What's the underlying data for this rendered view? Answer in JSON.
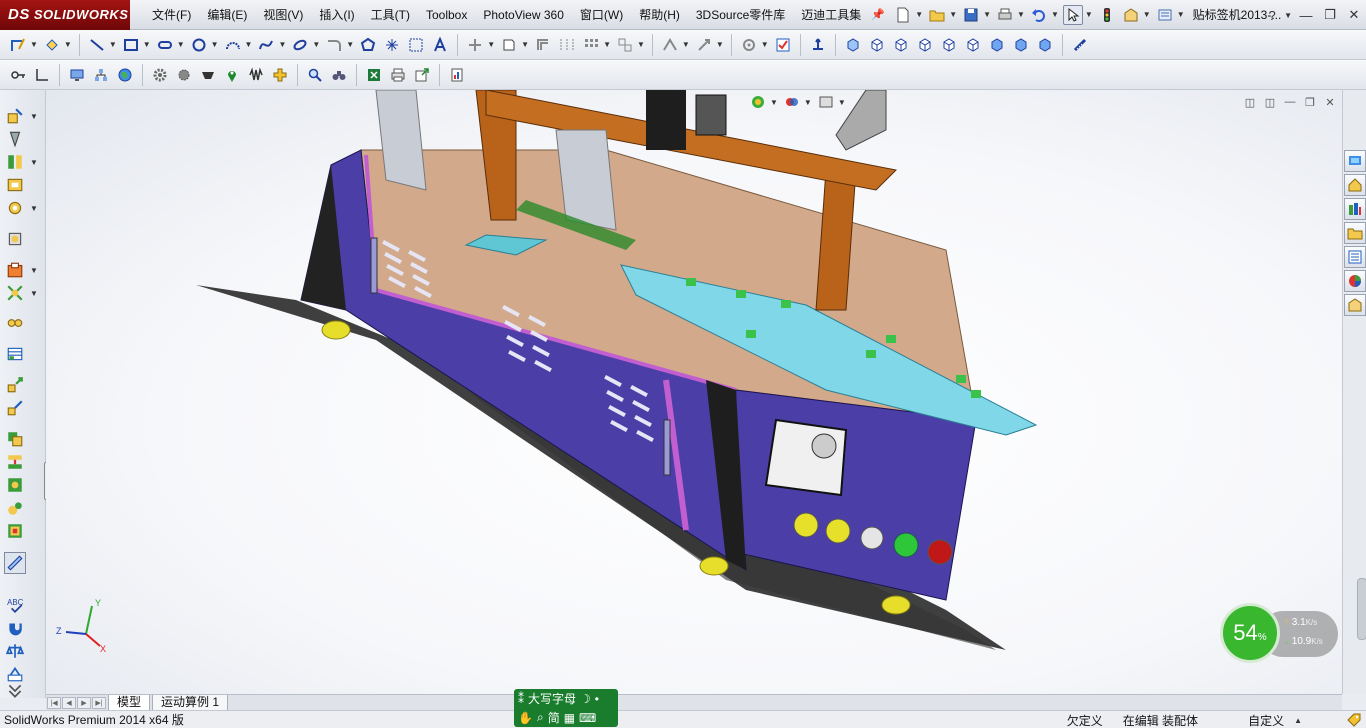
{
  "app": {
    "logo_brand": "DS",
    "logo_text": "SOLIDWORKS",
    "document_title": "贴标签机2013-..."
  },
  "menu": [
    {
      "label": "文件(F)"
    },
    {
      "label": "编辑(E)"
    },
    {
      "label": "视图(V)"
    },
    {
      "label": "插入(I)"
    },
    {
      "label": "工具(T)"
    },
    {
      "label": "Toolbox"
    },
    {
      "label": "PhotoView 360"
    },
    {
      "label": "窗口(W)"
    },
    {
      "label": "帮助(H)"
    },
    {
      "label": "3DSource零件库"
    },
    {
      "label": "迈迪工具集"
    }
  ],
  "window_buttons": {
    "help": "?",
    "minimize": "—",
    "restore": "❐",
    "close": "✕"
  },
  "viewport_controls": {
    "minimize": "—",
    "restore": "❐",
    "close": "✕"
  },
  "triad": {
    "x": "X",
    "y": "Y",
    "z": "Z"
  },
  "bottom_tabs": [
    {
      "label": "模型",
      "active": true
    },
    {
      "label": "运动算例 1",
      "active": false
    }
  ],
  "ime": {
    "caps": "大写字母",
    "mode": "简"
  },
  "net_monitor": {
    "percent": "54",
    "percent_unit": "%",
    "upload": "3.1",
    "upload_unit": "K/s",
    "download": "10.9",
    "download_unit": "K/s"
  },
  "status": {
    "product": "SolidWorks Premium 2014 x64 版",
    "underdefined": "欠定义",
    "editing": "在编辑 装配体",
    "custom": "自定义"
  },
  "colors": {
    "accent_red": "#a51414",
    "panel_purple": "#4b3fa7",
    "frame_orange": "#b8621a",
    "plate_cyan": "#7fd7e8",
    "net_green": "#38b72f"
  }
}
